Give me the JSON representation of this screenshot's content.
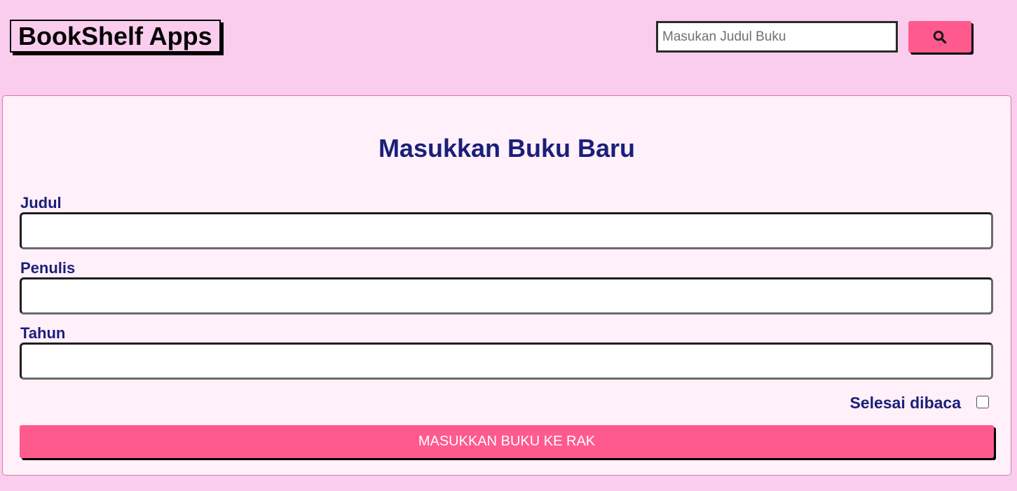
{
  "header": {
    "app_title": "BookShelf Apps",
    "search": {
      "placeholder": "Masukan Judul Buku",
      "value": "",
      "button_icon": "search-icon"
    }
  },
  "form": {
    "title": "Masukkan Buku Baru",
    "fields": {
      "title_label": "Judul",
      "title_value": "",
      "author_label": "Penulis",
      "author_value": "",
      "year_label": "Tahun",
      "year_value": ""
    },
    "finished_label": "Selesai dibaca",
    "finished_checked": false,
    "submit_label": "MASUKKAN BUKU KE RAK"
  },
  "colors": {
    "background": "#facdee",
    "card_background": "#fff0f9",
    "accent": "#ff5a8d",
    "heading": "#1a1f7a"
  }
}
